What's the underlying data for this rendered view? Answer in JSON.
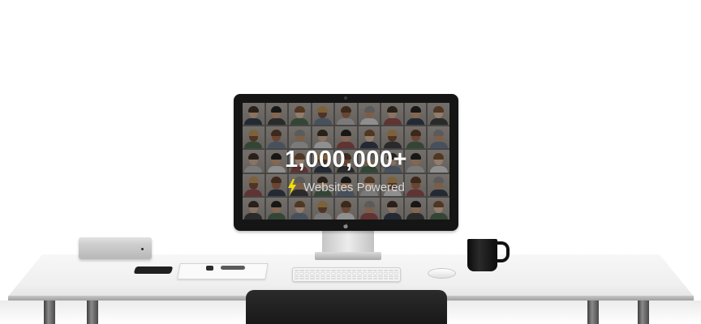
{
  "hero": {
    "counter": "1,000,000+",
    "caption": "Websites Powered"
  },
  "icons": {
    "bolt": "lightning-bolt-icon",
    "logo": "apple-logo-icon"
  },
  "colors": {
    "bolt": "#f2e000",
    "screen_overlay": "#141414",
    "counter_text": "#ffffff",
    "caption_text": "#d9d9d9"
  }
}
